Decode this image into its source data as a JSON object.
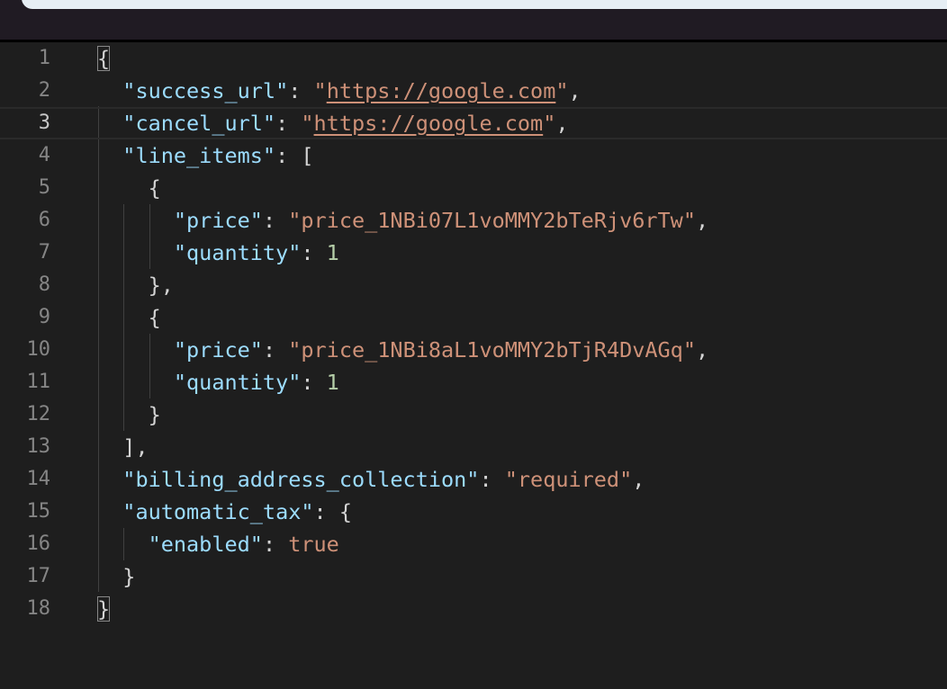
{
  "top": {},
  "editor": {
    "active_line": 3,
    "lines": [
      {
        "number": "1",
        "indent": "",
        "tokens": [
          {
            "t": "{",
            "c": "b",
            "bracket_match": true
          }
        ]
      },
      {
        "number": "2",
        "indent": "  ",
        "tokens": [
          {
            "t": "\"success_url\"",
            "c": "k"
          },
          {
            "t": ": ",
            "c": "b"
          },
          {
            "t": "\"",
            "c": "s"
          },
          {
            "t": "https://google.com",
            "c": "s",
            "underline": true
          },
          {
            "t": "\"",
            "c": "s"
          },
          {
            "t": ",",
            "c": "b"
          }
        ]
      },
      {
        "number": "3",
        "indent": "  ",
        "tokens": [
          {
            "t": "\"cancel_url\"",
            "c": "k"
          },
          {
            "t": ": ",
            "c": "b"
          },
          {
            "t": "\"",
            "c": "s"
          },
          {
            "t": "https://google.com",
            "c": "s",
            "underline": true
          },
          {
            "t": "\"",
            "c": "s"
          },
          {
            "t": ",",
            "c": "b"
          }
        ]
      },
      {
        "number": "4",
        "indent": "  ",
        "tokens": [
          {
            "t": "\"line_items\"",
            "c": "k"
          },
          {
            "t": ": [",
            "c": "b"
          }
        ]
      },
      {
        "number": "5",
        "indent": "    ",
        "tokens": [
          {
            "t": "{",
            "c": "b"
          }
        ]
      },
      {
        "number": "6",
        "indent": "      ",
        "tokens": [
          {
            "t": "\"price\"",
            "c": "k"
          },
          {
            "t": ": ",
            "c": "b"
          },
          {
            "t": "\"price_1NBi07L1voMMY2bTeRjv6rTw\"",
            "c": "s"
          },
          {
            "t": ",",
            "c": "b"
          }
        ]
      },
      {
        "number": "7",
        "indent": "      ",
        "tokens": [
          {
            "t": "\"quantity\"",
            "c": "k"
          },
          {
            "t": ": ",
            "c": "b"
          },
          {
            "t": "1",
            "c": "n"
          }
        ]
      },
      {
        "number": "8",
        "indent": "    ",
        "tokens": [
          {
            "t": "},",
            "c": "b"
          }
        ]
      },
      {
        "number": "9",
        "indent": "    ",
        "tokens": [
          {
            "t": "{",
            "c": "b"
          }
        ]
      },
      {
        "number": "10",
        "indent": "      ",
        "tokens": [
          {
            "t": "\"price\"",
            "c": "k"
          },
          {
            "t": ": ",
            "c": "b"
          },
          {
            "t": "\"price_1NBi8aL1voMMY2bTjR4DvAGq\"",
            "c": "s"
          },
          {
            "t": ",",
            "c": "b"
          }
        ]
      },
      {
        "number": "11",
        "indent": "      ",
        "tokens": [
          {
            "t": "\"quantity\"",
            "c": "k"
          },
          {
            "t": ": ",
            "c": "b"
          },
          {
            "t": "1",
            "c": "n"
          }
        ]
      },
      {
        "number": "12",
        "indent": "    ",
        "tokens": [
          {
            "t": "}",
            "c": "b"
          }
        ]
      },
      {
        "number": "13",
        "indent": "  ",
        "tokens": [
          {
            "t": "],",
            "c": "b"
          }
        ]
      },
      {
        "number": "14",
        "indent": "  ",
        "tokens": [
          {
            "t": "\"billing_address_collection\"",
            "c": "k"
          },
          {
            "t": ": ",
            "c": "b"
          },
          {
            "t": "\"required\"",
            "c": "s"
          },
          {
            "t": ",",
            "c": "b"
          }
        ]
      },
      {
        "number": "15",
        "indent": "  ",
        "tokens": [
          {
            "t": "\"automatic_tax\"",
            "c": "k"
          },
          {
            "t": ": {",
            "c": "b"
          }
        ]
      },
      {
        "number": "16",
        "indent": "    ",
        "tokens": [
          {
            "t": "\"enabled\"",
            "c": "k"
          },
          {
            "t": ": ",
            "c": "b"
          },
          {
            "t": "true",
            "c": "s"
          }
        ]
      },
      {
        "number": "17",
        "indent": "  ",
        "tokens": [
          {
            "t": "}",
            "c": "b"
          }
        ]
      },
      {
        "number": "18",
        "indent": "",
        "tokens": [
          {
            "t": "}",
            "c": "b",
            "bracket_match": true
          }
        ]
      }
    ]
  }
}
